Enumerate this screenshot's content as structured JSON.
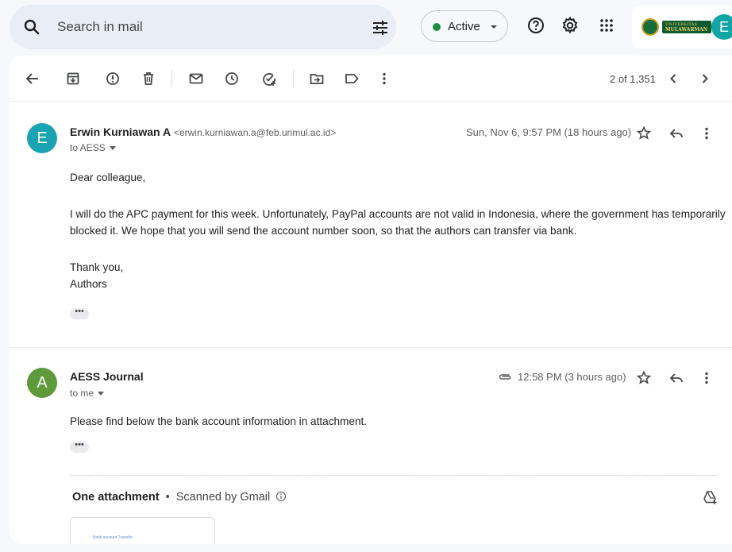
{
  "search": {
    "placeholder": "Search in mail"
  },
  "status": {
    "label": "Active",
    "color": "#1e8e3e"
  },
  "account": {
    "initial": "E",
    "logo_line1": "UNIVERSITAS",
    "logo_line2": "MULAWARMAN"
  },
  "toolbar": {
    "pagination": "2 of 1,351"
  },
  "messages": [
    {
      "initial": "E",
      "avatar_color": "#1aa3b0",
      "sender_name": "Erwin Kurniawan A",
      "sender_email": "<erwin.kurniawan.a@feb.unmul.ac.id>",
      "to": "to AESS",
      "date": "Sun, Nov 6, 9:57 PM (18 hours ago)",
      "greeting": "Dear colleague,",
      "paragraph_line1": "I will do the APC payment for this week. Unfortunately, PayPal accounts are not valid in Indonesia, where the government has temporarily",
      "paragraph_line2": "blocked it. We hope that you will send the account number soon, so that the authors can transfer via bank.",
      "closing1": "Thank you,",
      "closing2": "Authors",
      "more": "•••"
    },
    {
      "initial": "A",
      "avatar_color": "#5f9a3a",
      "sender_name": "AESS Journal",
      "to": "to me",
      "date": "12:58 PM (3 hours ago)",
      "body": "Please find below the bank account information in attachment.",
      "more": "•••"
    }
  ],
  "attachments": {
    "title": "One attachment",
    "separator": "•",
    "scanned": "Scanned by Gmail",
    "thumbnail_text": "Bank account Transfer"
  }
}
